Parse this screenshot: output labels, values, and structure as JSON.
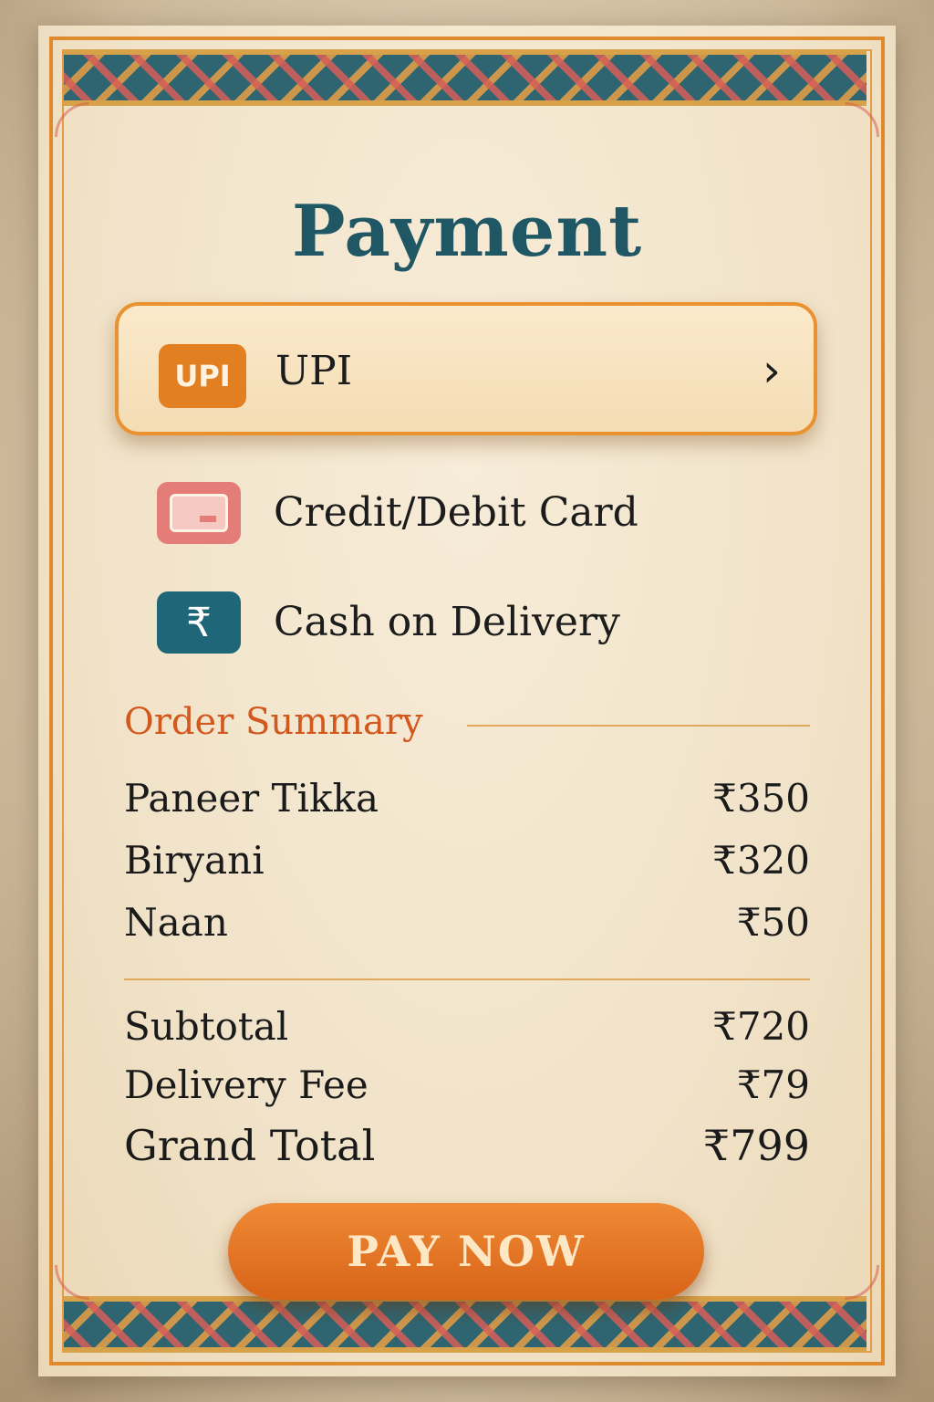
{
  "title": "Payment",
  "payment_methods": {
    "upi": {
      "badge": "UPI",
      "label": "UPI",
      "chevron": "›"
    },
    "card": {
      "label": "Credit/Debit Card",
      "icon": "credit-card-icon"
    },
    "cash": {
      "label": "Cash on Delivery",
      "icon_glyph": "₹"
    }
  },
  "order_summary": {
    "title": "Order Summary",
    "items": [
      {
        "name": "Paneer Tikka",
        "price": "₹350"
      },
      {
        "name": "Biryani",
        "price": "₹320"
      },
      {
        "name": "Naan",
        "price": "₹50"
      }
    ],
    "subtotal": {
      "label": "Subtotal",
      "value": "₹720"
    },
    "delivery_fee": {
      "label": "Delivery Fee",
      "value": "₹79"
    },
    "grand_total": {
      "label": "Grand Total",
      "value": "₹799"
    }
  },
  "pay_button": "PAY NOW",
  "colors": {
    "accent": "#e27f21",
    "title": "#1f5764",
    "summary_heading": "#d2581e",
    "card_icon": "#e47d77",
    "cash_icon": "#1f6678"
  }
}
